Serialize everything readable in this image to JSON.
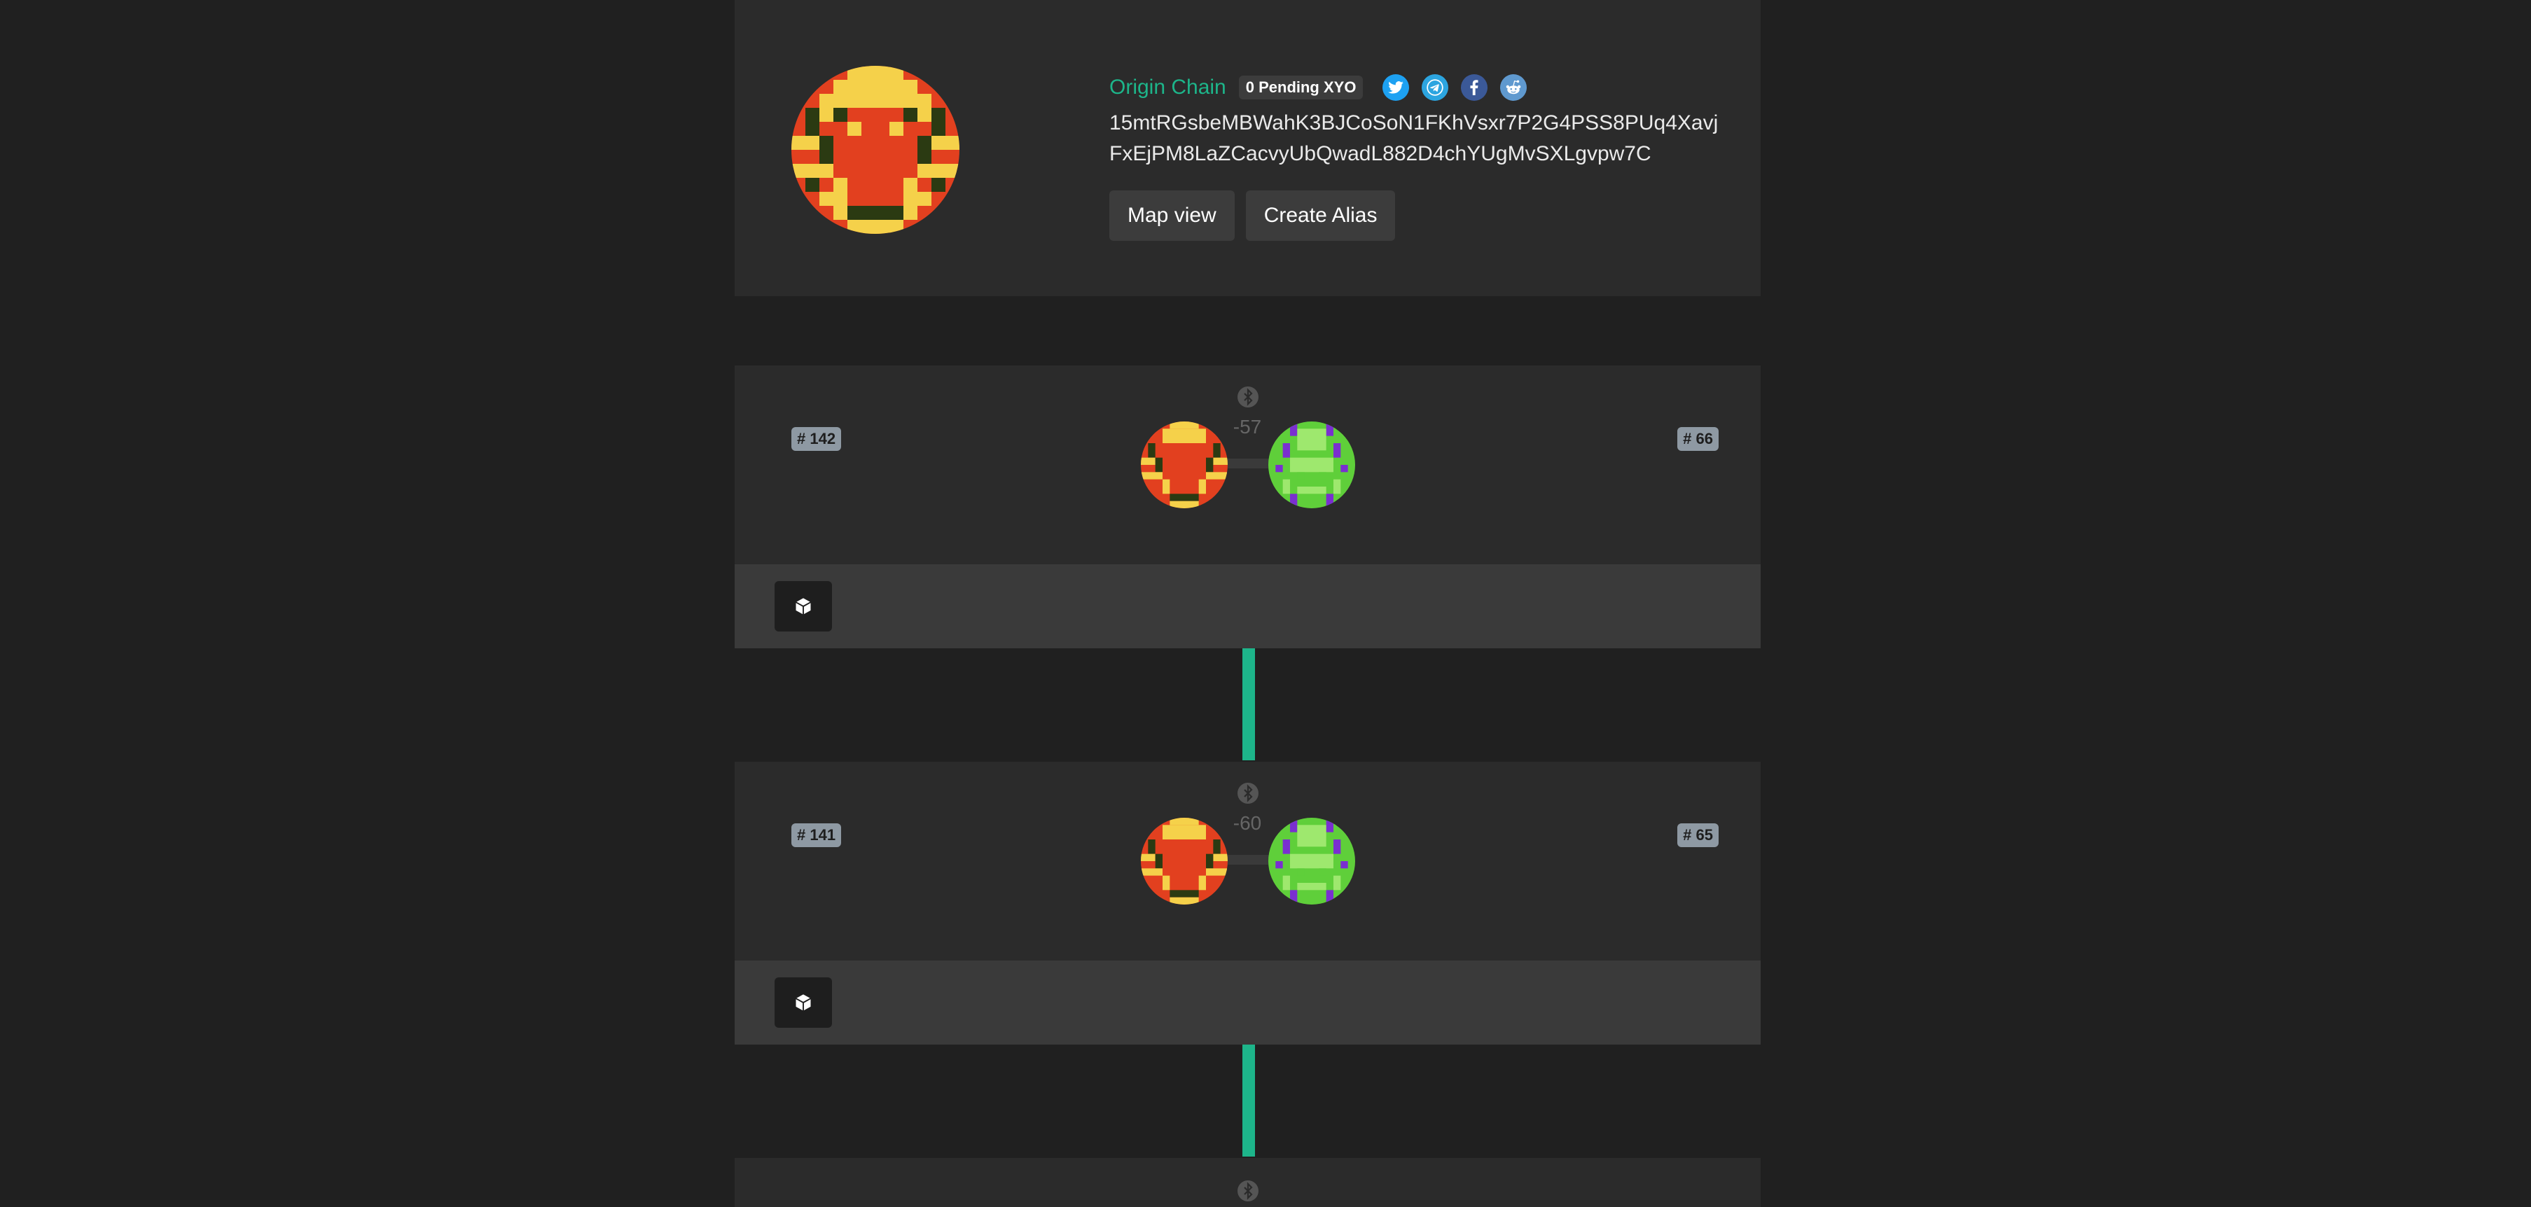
{
  "header": {
    "origin_label": "Origin Chain",
    "pending_label": "0 Pending XYO",
    "address_line1": "15mtRGsbeMBWahK3BJCoSoN1FKhVsxr7P2G4PSS8PUq4Xavj",
    "address_line2": "FxEjPM8LaZCacvyUbQwadL882D4chYUgMvSXLgvpw7C",
    "map_view_label": "Map view",
    "create_alias_label": "Create Alias",
    "social": [
      "twitter-icon",
      "telegram-icon",
      "facebook-icon",
      "reddit-icon"
    ]
  },
  "blocks": [
    {
      "left_index": "# 142",
      "right_index": "# 66",
      "rssi": "-57"
    },
    {
      "left_index": "# 141",
      "right_index": "# 65",
      "rssi": "-60"
    },
    {
      "left_index": "",
      "right_index": "",
      "rssi": ""
    }
  ],
  "colors": {
    "accent": "#1db58a",
    "background": "#202020",
    "card": "#2b2b2b",
    "card_footer": "#3a3a3a",
    "badge": "#8e99a3",
    "origin_avatar": [
      "#e2401f",
      "#f5d14a",
      "#2b3a12"
    ],
    "peer_avatar": [
      "#5fcf3a",
      "#9ee86e",
      "#7a2fd0"
    ]
  }
}
